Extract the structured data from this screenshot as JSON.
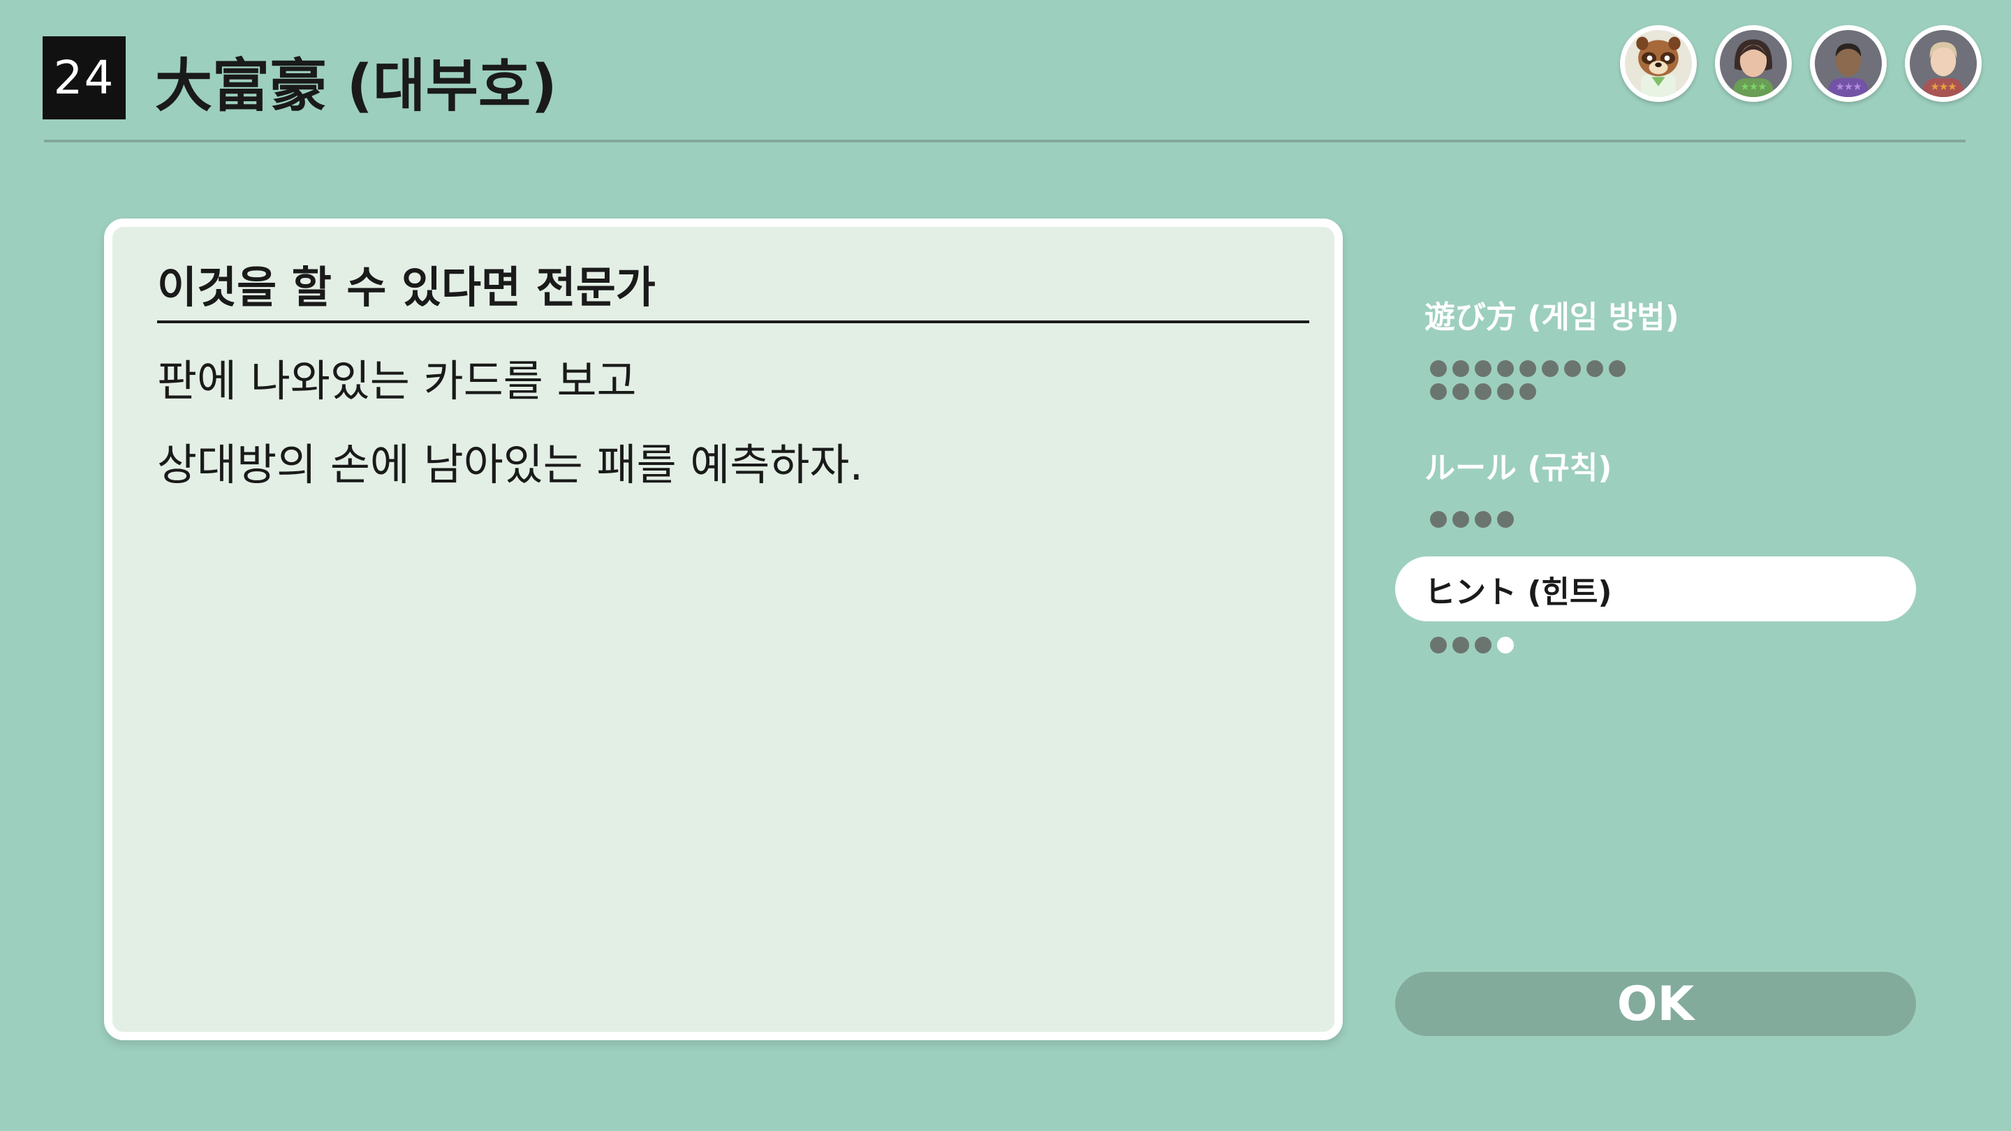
{
  "header": {
    "game_number": "24",
    "game_title": "大富豪 (대부호)"
  },
  "players": [
    {
      "name": "tanuki-avatar",
      "stars": ""
    },
    {
      "name": "mii-avatar-1",
      "stars": "★★★"
    },
    {
      "name": "mii-avatar-2",
      "stars": "★★★"
    },
    {
      "name": "mii-avatar-3",
      "stars": "★★★"
    }
  ],
  "panel": {
    "heading": "이것을 할 수 있다면 전문가",
    "line1": "판에 나와있는 카드를 보고",
    "line2": "상대방의 손에 남아있는 패를 예측하자."
  },
  "sections": {
    "how_to_play": {
      "label": "遊び方 (게임 방법)",
      "pages": 14,
      "current": null
    },
    "rules": {
      "label": "ルール (규칙)",
      "pages": 4,
      "current": null
    },
    "hints": {
      "label": "ヒント (힌트)",
      "pages": 4,
      "current": 4
    }
  },
  "ok_button": {
    "label": "OK"
  },
  "colors": {
    "background": "#9dcfbe",
    "panel": "#e3efe5",
    "dot": "#6b756f",
    "ok_button": "#82ab9c"
  }
}
